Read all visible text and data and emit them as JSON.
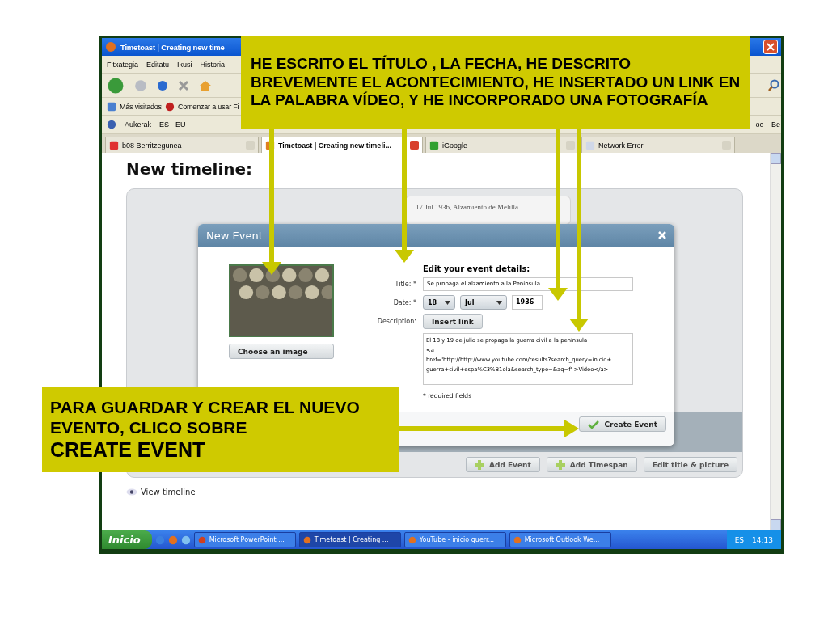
{
  "callouts": [
    {
      "kind": "top",
      "text": "HE ESCRITO EL TÍTULO , LA FECHA, HE DESCRITO BREVEMENTE EL ACONTECIMIENTO, HE INSERTADO UN LINK EN LA PALABRA VÍDEO, Y HE INCORPORADO UNA FOTOGRAFÍA"
    },
    {
      "kind": "bottom",
      "text": "PARA GUARDAR Y CREAR EL NUEVO EVENTO, CLICO SOBRE",
      "emphasis": "CREATE EVENT"
    }
  ],
  "window": {
    "title": "Timetoast | Creating new time"
  },
  "menu": [
    "Fitxategia",
    "Editatu",
    "Ikusi",
    "Historia"
  ],
  "bookmarks": [
    "Más visitados",
    "Comenzar a usar Fi"
  ],
  "addon_bar": {
    "items": [
      "Aukerak",
      "ES · EU"
    ],
    "right": [
      "oc",
      "Be"
    ]
  },
  "tabs": [
    {
      "label": "b08 Berritzegunea",
      "selected": false
    },
    {
      "label": "Timetoast | Creating new timeli...",
      "selected": true
    },
    {
      "label": "iGoogle",
      "selected": false
    },
    {
      "label": "Network Error",
      "selected": false
    }
  ],
  "page": {
    "heading": "New timeline:",
    "event_card": "17 Jul 1936, Alzamiento de Melilla",
    "buttons": [
      "Add Event",
      "Add Timespan",
      "Edit title & picture"
    ],
    "view_link": "View timeline"
  },
  "dialog": {
    "title": "New Event",
    "choose_image": "Choose an image",
    "section_title": "Edit your event details:",
    "title_label": "Title: *",
    "title_value": "Se propaga el alzamiento a la Península",
    "date_label": "Date: *",
    "day": "18",
    "month": "Jul",
    "year": "1936",
    "description_label": "Description:",
    "insert_link": "Insert link",
    "description_value": "El 18 y 19 de julio se propaga la guerra civil a la península\n<a\nhref='http://http://www.youtube.com/results?search_query=inicio+\nguerra+civil+espa%C3%B1ola&search_type=&aq=f' >Video</a>",
    "required_note": "* required fields",
    "submit": "Create Event"
  },
  "taskbar": {
    "start": "Inicio",
    "tasks": [
      {
        "label": "Microsoft PowerPoint ...",
        "selected": false
      },
      {
        "label": "Timetoast | Creating ...",
        "selected": true
      },
      {
        "label": "YouTube - inicio guerr...",
        "selected": false
      },
      {
        "label": "Microsoft Outlook We...",
        "selected": false
      }
    ],
    "language": "ES",
    "clock": "14:13"
  }
}
